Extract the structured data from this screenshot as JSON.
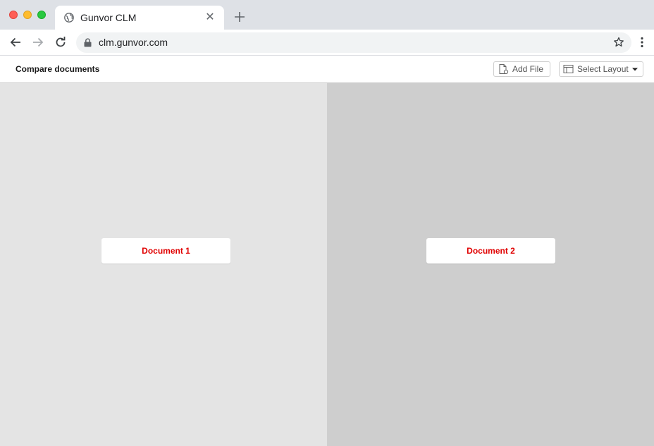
{
  "browser": {
    "tab_title": "Gunvor CLM",
    "url": "clm.gunvor.com",
    "icons": [
      "globe-icon",
      "close-icon",
      "plus-icon",
      "back-arrow-icon",
      "forward-arrow-icon",
      "reload-icon",
      "lock-icon",
      "star-icon",
      "kebab-menu-icon"
    ]
  },
  "app": {
    "title": "Compare documents",
    "add_file_label": "Add File",
    "select_layout_label": "Select Layout"
  },
  "panes": [
    {
      "document_label": "Document 1"
    },
    {
      "document_label": "Document 2"
    }
  ],
  "colors": {
    "document_label": "#e00000",
    "left_pane": "#e4e4e4",
    "right_pane": "#cecece"
  }
}
